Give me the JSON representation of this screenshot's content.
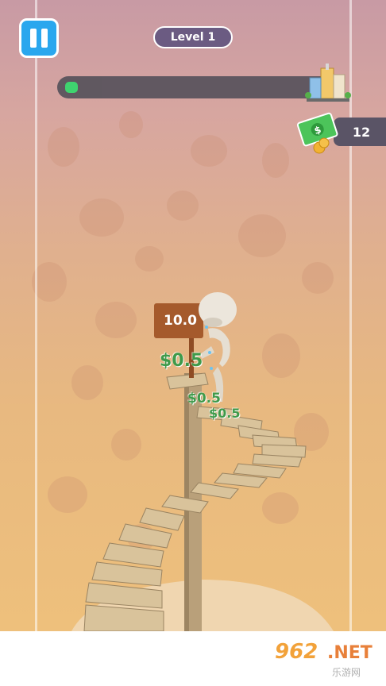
{
  "hud": {
    "level_label": "Level 1",
    "progress_fraction": 0.05,
    "money_count": "12"
  },
  "game": {
    "sign_value": "10.0",
    "cash_popups": [
      "$0.5",
      "$0.5",
      "$0.5"
    ]
  },
  "watermark": {
    "number": "962",
    "net": ".NET",
    "chinese": "乐游网"
  },
  "icons": {
    "pause": "pause-icon",
    "goal": "city-buildings-icon",
    "money": "cash-bill-icon"
  },
  "colors": {
    "pause_bg": "#2aa7ee",
    "level_pill": "#6b5b82",
    "progress_fill": "#2fd96a",
    "cash_text": "#3f9a4a",
    "sign": "#a55a2c"
  }
}
